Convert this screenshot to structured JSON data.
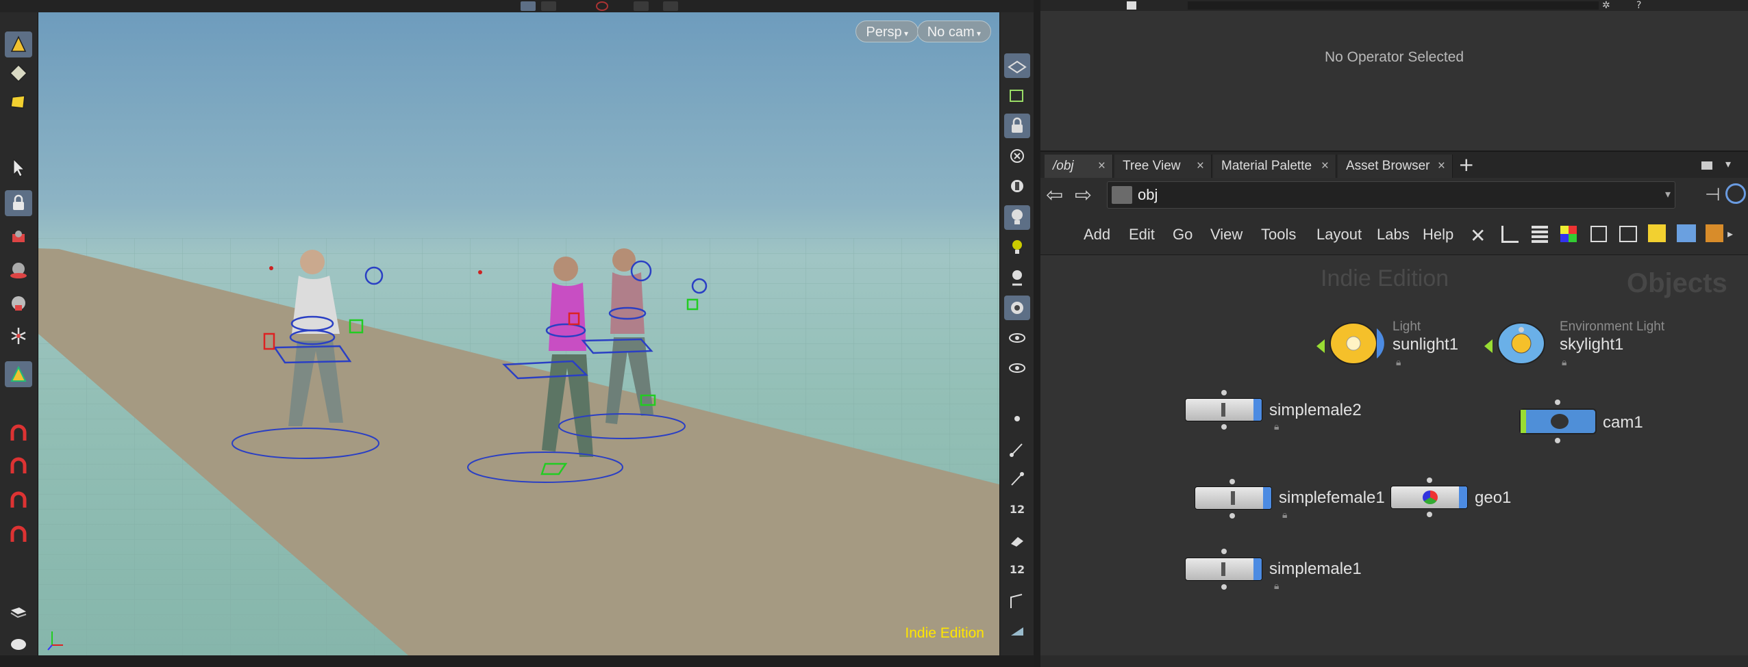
{
  "viewport": {
    "persp_label": "Persp",
    "cam_label": "No cam",
    "edition": "Indie Edition"
  },
  "parameter_pane": {
    "message": "No Operator Selected"
  },
  "network": {
    "tabs": [
      {
        "label": "/obj"
      },
      {
        "label": "Tree View"
      },
      {
        "label": "Material Palette"
      },
      {
        "label": "Asset Browser"
      }
    ],
    "add_tab": "+",
    "path": "obj",
    "menu": [
      "Add",
      "Edit",
      "Go",
      "View",
      "Tools",
      "Layout",
      "Labs",
      "Help"
    ],
    "watermark": "Indie Edition",
    "context_label": "Objects",
    "nodes": {
      "sunlight": {
        "type": "Light",
        "name": "sunlight1"
      },
      "skylight": {
        "type": "Environment Light",
        "name": "skylight1"
      },
      "simplemale2": {
        "name": "simplemale2"
      },
      "cam": {
        "name": "cam1"
      },
      "simplefemale": {
        "name": "simplefemale1"
      },
      "geo": {
        "name": "geo1"
      },
      "simplemale1": {
        "name": "simplemale1"
      }
    }
  },
  "colors": {
    "accent_selected_tool": "#5d6f86",
    "node_blue": "#4c8be2",
    "edition_yellow": "#ffe600",
    "light_yellow": "#f5c02a"
  },
  "icons": {
    "left_tools": [
      "select-tool-icon",
      "translate-tool-icon",
      "rotate-tool-icon",
      "pose-tool-icon",
      "handle-tool-icon",
      "magnet-icon"
    ],
    "right_tools": [
      "display-options-icon",
      "lock-camera-icon",
      "light-icon",
      "snapshot-icon"
    ]
  }
}
